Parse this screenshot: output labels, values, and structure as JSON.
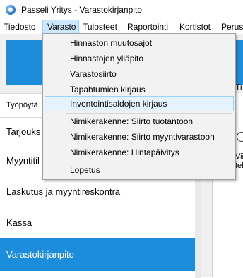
{
  "window": {
    "title": "Passeli Yritys - Varastokirjanpito"
  },
  "menubar": {
    "items": [
      "Tiedosto",
      "Varasto",
      "Tulosteet",
      "Raportointi",
      "Kortistot",
      "Perust"
    ],
    "active_index": 1
  },
  "dropdown": {
    "group1": [
      "Hinnaston muutosajot",
      "Hinnastojen ylläpito",
      "Varastosiirto",
      "Tapahtumien kirjaus",
      "Inventointisaldojen kirjaus"
    ],
    "group2": [
      "Nimikerakenne: Siirto tuotantoon",
      "Nimikerakenne: Siirto myyntivarastoon",
      "Nimikerakenne: Hintapäivitys"
    ],
    "group3": [
      "Lopetus"
    ],
    "hovered": "Inventointisaldojen kirjaus"
  },
  "nav": {
    "items": [
      "Työpöytä",
      "Tarjouks",
      "Myyntitil",
      "Laskutus ja myyntireskontra",
      "Kassa",
      "Varastokirjanpito"
    ],
    "selected": "Varastokirjanpito"
  },
  "right_panel": {
    "col_label": "Ti",
    "p_label": "P",
    "text_line1": "Vii",
    "text_line2": "teh"
  },
  "colors": {
    "accent": "#1c8ddb",
    "menu_highlight": "#cce8ff",
    "hover_border": "#99d1ff"
  }
}
